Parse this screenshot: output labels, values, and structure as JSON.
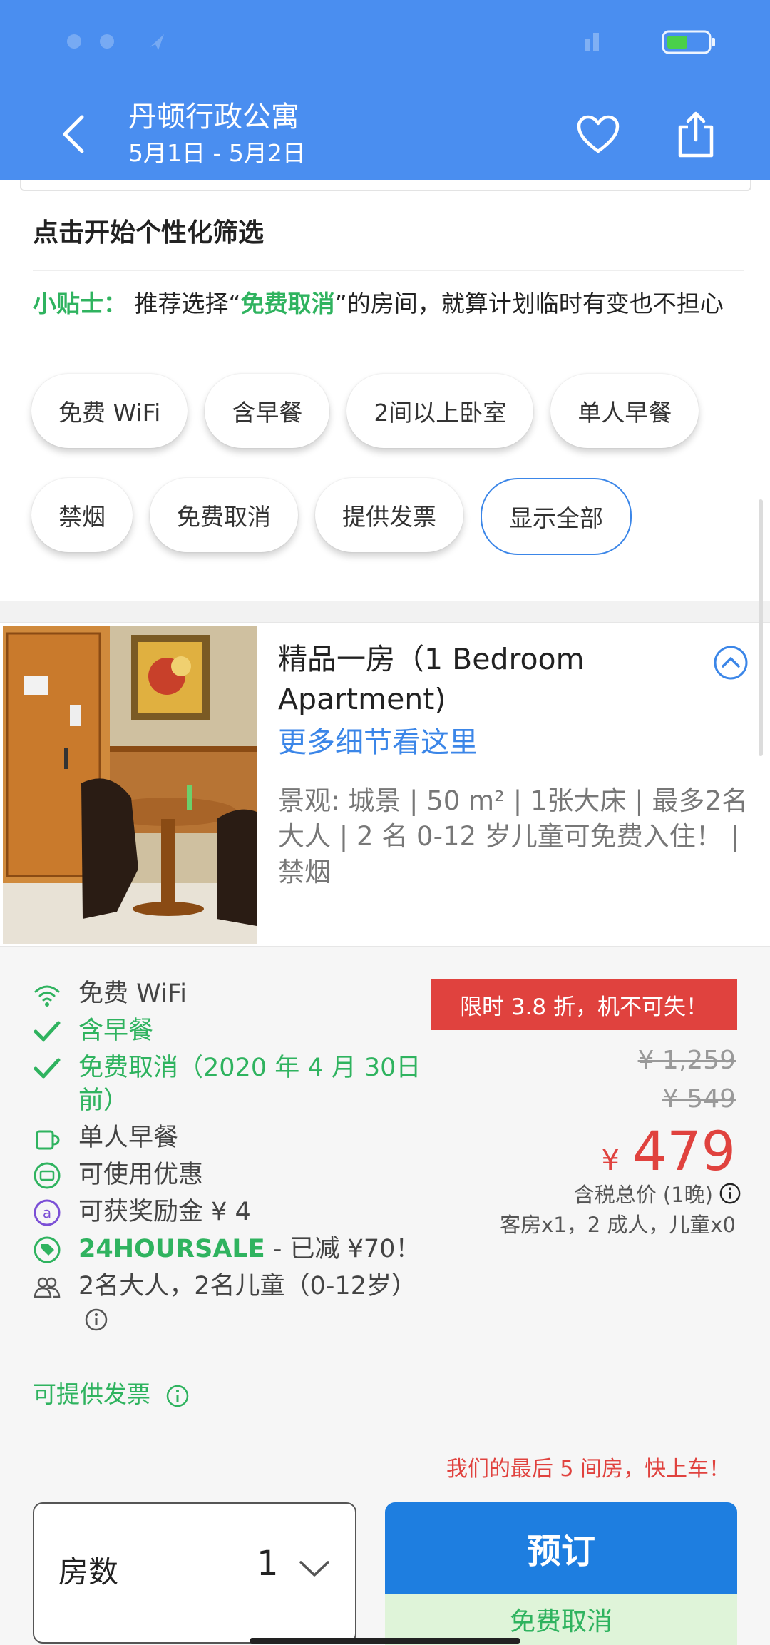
{
  "header": {
    "title": "丹顿行政公寓",
    "dates": "5月1日 - 5月2日"
  },
  "filter": {
    "title": "点击开始个性化筛选",
    "tip_label": "小贴士：",
    "tip_text_1": "推荐选择“",
    "tip_highlight": "免费取消",
    "tip_text_2": "”的房间，就算计划临时有变也不担心",
    "chips_row1": [
      "免费 WiFi",
      "含早餐",
      "2间以上卧室",
      "单人早餐"
    ],
    "chips_row2": [
      "禁烟",
      "免费取消",
      "提供发票"
    ],
    "show_all": "显示全部"
  },
  "room": {
    "name": "精品一房（1 Bedroom Apartment)",
    "details_link": "更多细节看这里",
    "description": "景观: 城景 | 50 m² | 1张大床 | 最多2名大人 | 2 名 0-12 岁儿童可免费入住！ | 禁烟"
  },
  "features": {
    "wifi": "免费 WiFi",
    "breakfast": "含早餐",
    "free_cancel": "免费取消",
    "free_cancel_date": "（2020 年 4 月 30日前）",
    "single_breakfast": "单人早餐",
    "coupon": "可使用优惠",
    "reward": "可获奖励金 ¥ 4",
    "sale_code": "24HOURSALE",
    "sale_text": " - 已减 ¥70！",
    "guests": "2名大人，2名儿童（0-12岁）",
    "invoice": "可提供发票"
  },
  "price": {
    "deal": "限时 3.8 折，机不可失！",
    "original_1": "¥ 1,259",
    "original_2": "¥ 549",
    "currency": "¥",
    "amount": "479",
    "note": "含税总价 (1晚)",
    "summary": "客房x1，2 成人，儿童x0"
  },
  "booking": {
    "last_rooms": "我们的最后 5 间房，快上车！",
    "rooms_label": "房数",
    "rooms_value": "1",
    "book_label": "预订",
    "book_sub": "免费取消"
  },
  "colors": {
    "header_blue": "#4a8ef0",
    "accent_green": "#2fb35f",
    "accent_red": "#e0423e",
    "button_blue": "#1e7ee0"
  }
}
